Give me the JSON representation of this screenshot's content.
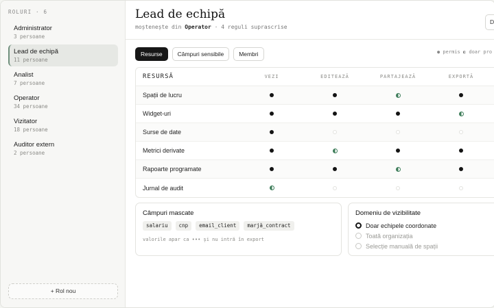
{
  "sidebar": {
    "heading": "ROLURI · 6",
    "roles": [
      {
        "name": "Administrator",
        "count": "3 persoane"
      },
      {
        "name": "Lead de echipă",
        "count": "11 persoane"
      },
      {
        "name": "Analist",
        "count": "7 persoane"
      },
      {
        "name": "Operator",
        "count": "34 persoane"
      },
      {
        "name": "Vizitator",
        "count": "18 persoane"
      },
      {
        "name": "Auditor extern",
        "count": "2 persoane"
      }
    ],
    "active_index": 1,
    "add_label": "+ Rol nou"
  },
  "header": {
    "title": "Lead de echipă",
    "inherits_prefix": "moștenește din",
    "inherits_role": "Operator",
    "overrides": "· 4 reguli suprascrise",
    "top_button": "D"
  },
  "tabs": [
    {
      "label": "Resurse",
      "active": true
    },
    {
      "label": "Câmpuri sensibile",
      "active": false
    },
    {
      "label": "Membri",
      "active": false
    }
  ],
  "legend": "● permis  ◐ doar pro",
  "table": {
    "columns": [
      "RESURSĂ",
      "VEZI",
      "EDITEAZĂ",
      "PARTAJEAZĂ",
      "EXPORTĂ"
    ],
    "rows": [
      {
        "name": "Spații de lucru",
        "perms": [
          "full",
          "full",
          "half",
          "full"
        ]
      },
      {
        "name": "Widget-uri",
        "perms": [
          "full",
          "full",
          "full",
          "half"
        ]
      },
      {
        "name": "Surse de date",
        "perms": [
          "full",
          "none",
          "none",
          "none"
        ]
      },
      {
        "name": "Metrici derivate",
        "perms": [
          "full",
          "half",
          "full",
          "full"
        ]
      },
      {
        "name": "Rapoarte programate",
        "perms": [
          "full",
          "full",
          "half",
          "full"
        ]
      },
      {
        "name": "Jurnal de audit",
        "perms": [
          "half",
          "none",
          "none",
          "none"
        ]
      }
    ]
  },
  "masked": {
    "title": "Câmpuri mascate",
    "fields": [
      "salariu",
      "cnp",
      "email_client",
      "marjă_contract"
    ],
    "note": "valorile apar ca ••• și nu intră în export"
  },
  "scope": {
    "title": "Domeniu de vizibilitate",
    "options": [
      {
        "label": "Doar echipele coordonate",
        "selected": true
      },
      {
        "label": "Toată organizația",
        "selected": false
      },
      {
        "label": "Selecție manuală de spații",
        "selected": false
      }
    ]
  }
}
